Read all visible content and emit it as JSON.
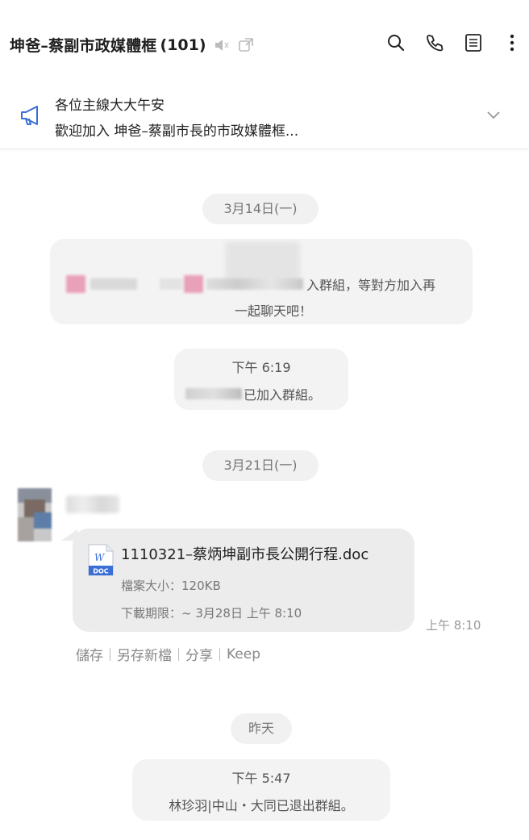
{
  "header": {
    "title": "坤爸–蔡副市政媒體框",
    "member_count": "(101)",
    "icons": [
      "mute-icon",
      "external-link-icon",
      "search-icon",
      "phone-icon",
      "notes-icon",
      "more-icon"
    ]
  },
  "announcement": {
    "line1": "各位主線大大午安",
    "line2": "歡迎加入 坤爸–蔡副市長的市政媒體框..."
  },
  "messages": {
    "date1": "3月14日(一)",
    "sys1_text_a": "入群組，等對方加入再",
    "sys1_text_b": "一起聊天吧！",
    "sys2_time": "下午 6:19",
    "sys2_text": "已加入群組。",
    "date2": "3月21日(一)",
    "file": {
      "name": "1110321–蔡炳坤副市長公開行程.doc",
      "size": "檔案大小：120KB",
      "expiry": "下載期限：~ 3月28日 上午 8:10",
      "icon_label": "DOC",
      "time": "上午 8:10"
    },
    "actions": [
      "儲存",
      "另存新檔",
      "分享",
      "Keep"
    ],
    "date3": "昨天",
    "sys3_time": "下午 5:47",
    "sys3_text": "林珍羽|中山・大同已退出群組。"
  },
  "colors": {
    "accent_blue": "#3b6fd6",
    "pill_bg": "#f1f1f1",
    "bubble_bg": "#ececec"
  }
}
